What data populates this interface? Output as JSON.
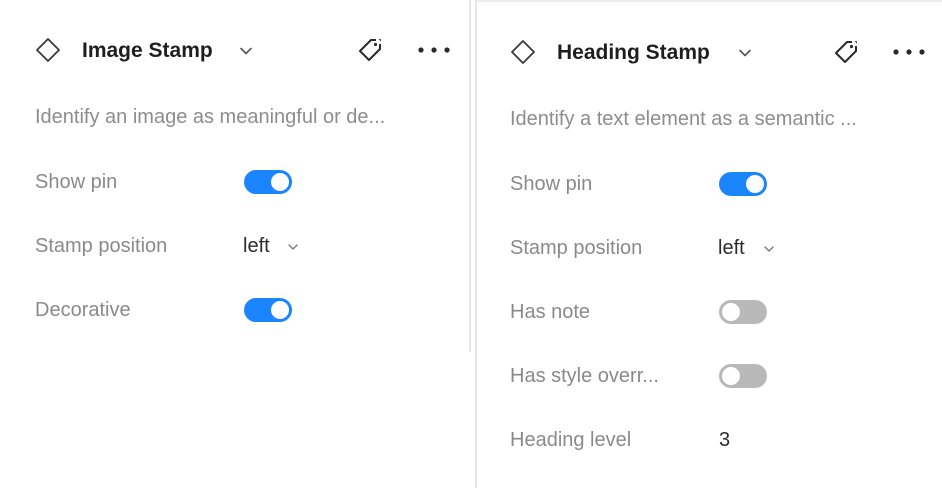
{
  "colors": {
    "accent": "#1b84ff",
    "toggle_off": "#b8b8b8",
    "label": "#8a8a8a",
    "title": "#1e1e1e"
  },
  "panels": [
    {
      "title": "Image Stamp",
      "description": "Identify an image as meaningful or de...",
      "icons": [
        "diamond-icon",
        "chevron-down-icon",
        "tag-icon",
        "more-icon"
      ],
      "properties": [
        {
          "label": "Show pin",
          "type": "toggle",
          "value": true
        },
        {
          "label": "Stamp position",
          "type": "select",
          "value": "left"
        },
        {
          "label": "Decorative",
          "type": "toggle",
          "value": true
        }
      ]
    },
    {
      "title": "Heading Stamp",
      "description": "Identify a text element as a semantic ...",
      "icons": [
        "diamond-icon",
        "chevron-down-icon",
        "tag-icon",
        "more-icon"
      ],
      "properties": [
        {
          "label": "Show pin",
          "type": "toggle",
          "value": true
        },
        {
          "label": "Stamp position",
          "type": "select",
          "value": "left"
        },
        {
          "label": "Has note",
          "type": "toggle",
          "value": false
        },
        {
          "label": "Has style overr...",
          "type": "toggle",
          "value": false
        },
        {
          "label": "Heading level",
          "type": "text",
          "value": "3"
        }
      ]
    }
  ]
}
